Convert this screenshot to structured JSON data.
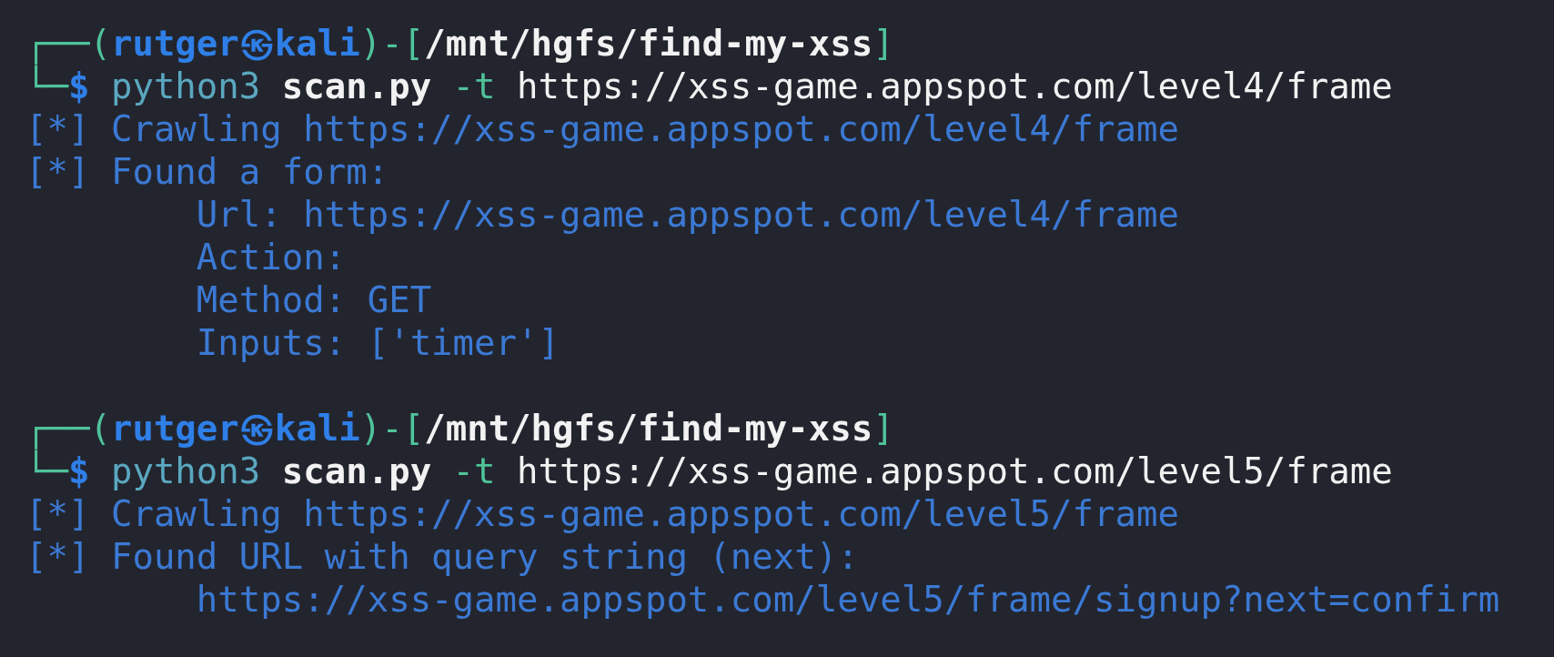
{
  "blocks": [
    {
      "prompt": {
        "frame_open": "┌──(",
        "user": "rutger",
        "separator": "㉿",
        "host": "kali",
        "frame_middle": ")-[",
        "path": "/mnt/hgfs/find-my-xss",
        "frame_close": "]",
        "frame_lead": "└─",
        "symbol": "$",
        "command": "python3",
        "script": "scan.py",
        "flag": "-t",
        "argument": "https://xss-game.appspot.com/level4/frame"
      },
      "output": [
        {
          "kind": "status",
          "marker": "[*]",
          "text": "Crawling https://xss-game.appspot.com/level4/frame"
        },
        {
          "kind": "status",
          "marker": "[*]",
          "text": "Found a form:"
        },
        {
          "kind": "detail",
          "text": "Url: https://xss-game.appspot.com/level4/frame"
        },
        {
          "kind": "detail",
          "text": "Action:"
        },
        {
          "kind": "detail",
          "text": "Method: GET"
        },
        {
          "kind": "detail",
          "text": "Inputs: ['timer']"
        }
      ]
    },
    {
      "prompt": {
        "frame_open": "┌──(",
        "user": "rutger",
        "separator": "㉿",
        "host": "kali",
        "frame_middle": ")-[",
        "path": "/mnt/hgfs/find-my-xss",
        "frame_close": "]",
        "frame_lead": "└─",
        "symbol": "$",
        "command": "python3",
        "script": "scan.py",
        "flag": "-t",
        "argument": "https://xss-game.appspot.com/level5/frame"
      },
      "output": [
        {
          "kind": "status",
          "marker": "[*]",
          "text": "Crawling https://xss-game.appspot.com/level5/frame"
        },
        {
          "kind": "status",
          "marker": "[*]",
          "text": "Found URL with query string (next):"
        },
        {
          "kind": "detail",
          "text": "https://xss-game.appspot.com/level5/frame/signup?next=confirm"
        }
      ]
    }
  ]
}
